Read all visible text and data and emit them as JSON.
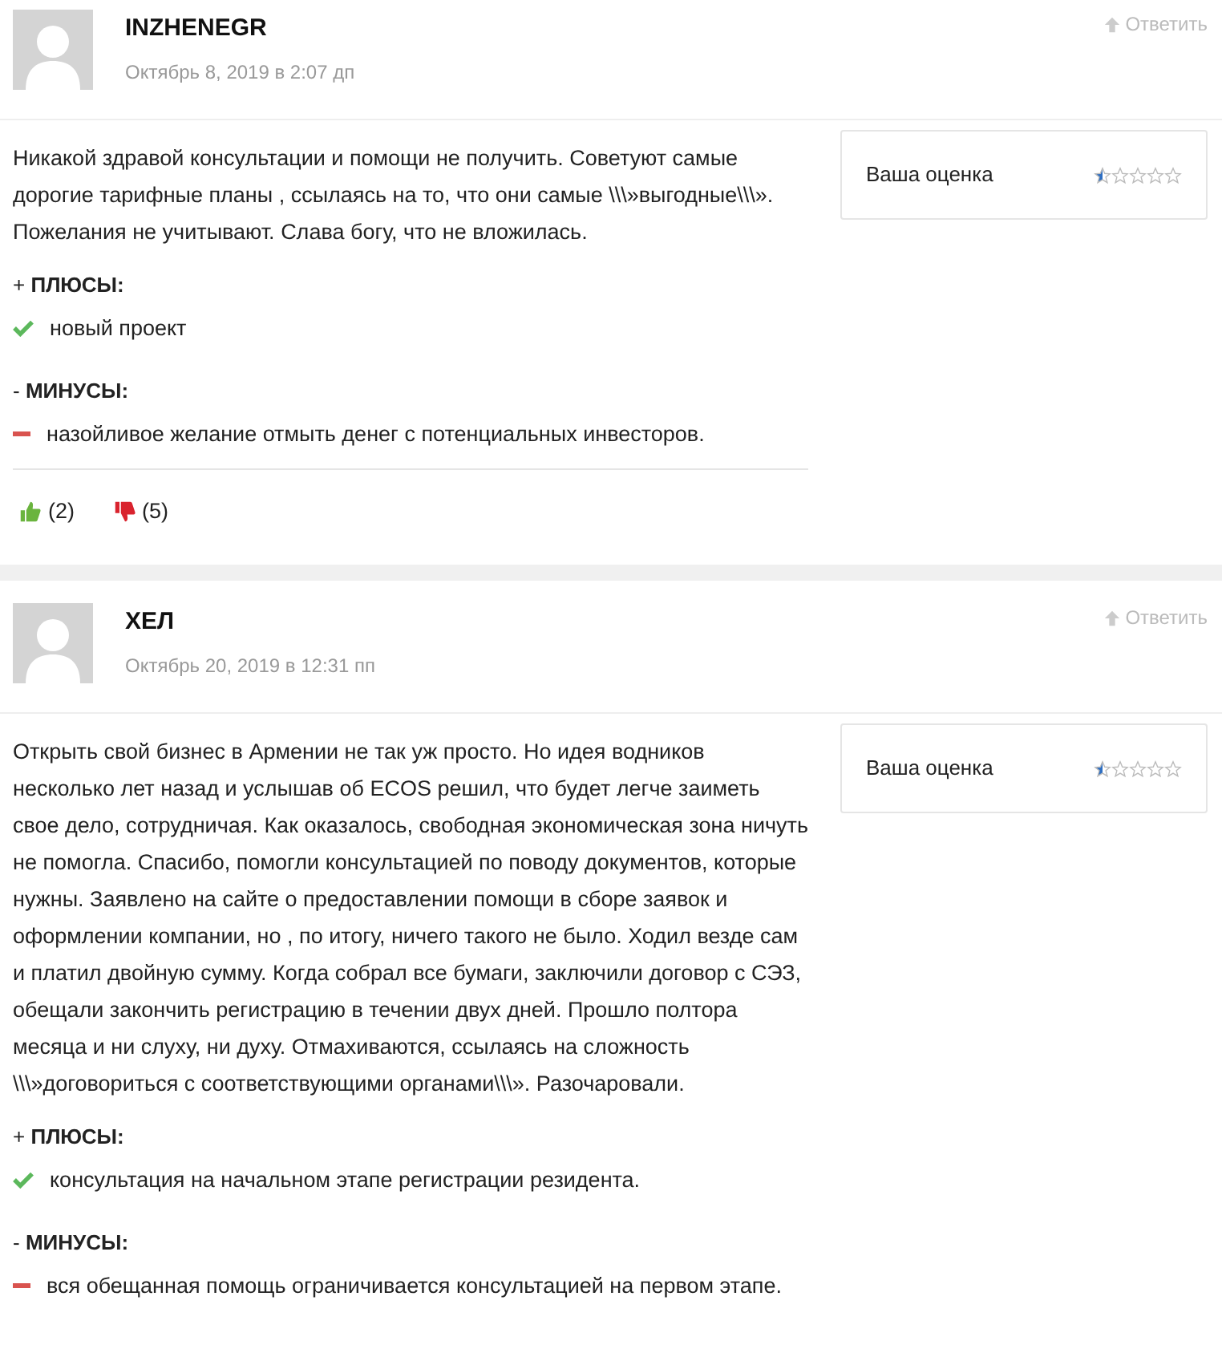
{
  "reviews": [
    {
      "author": "INZHENEGR",
      "date": "Октябрь 8, 2019 в 2:07 дп",
      "reply": "Ответить",
      "text": "Никакой здравой консультации и помощи не получить. Советуют самые дорогие тарифные планы , ссылаясь на то, что они самые \\\\\\»выгодные\\\\\\». Пожелания не учитывают. Слава богу, что не вложилась.",
      "rating_label": "Ваша оценка",
      "stars": 0.5,
      "pros_heading": "+ **ПЛЮСЫ:**",
      "pros": [
        "новый проект"
      ],
      "cons_heading": "- **МИНУСЫ:**",
      "cons": [
        "назойливое желание отмыть денег с потенциальных инвесторов."
      ],
      "likes": "(2)",
      "dislikes": "(5)"
    },
    {
      "author": "ХЕЛ",
      "date": "Октябрь 20, 2019 в 12:31 пп",
      "reply": "Ответить",
      "text": "Открыть свой бизнес в Армении не так уж просто. Но идея водников несколько лет назад и услышав об ECOS решил, что будет легче заиметь свое дело, сотрудничая. Как оказалось, свободная экономическая зона ничуть не помогла. Спасибо, помогли консультацией по поводу документов, которые нужны. Заявлено на сайте о предоставлении помощи в сборе заявок и оформлении компании, но , по итогу, ничего такого не было. Ходил везде сам и платил двойную сумму. Когда собрал все бумаги, заключили договор с СЭЗ, обещали закончить регистрацию в течении двух дней. Прошло полтора месяца и ни слуху, ни духу. Отмахиваются, ссылаясь на сложность \\\\\\»договориться с соответствующими органами\\\\\\». Разочаровали.",
      "rating_label": "Ваша оценка",
      "stars": 0.5,
      "pros_heading": "+ **ПЛЮСЫ:**",
      "pros": [
        "консультация на начальном этапе регистрации резидента."
      ],
      "cons_heading": "- **МИНУСЫ:**",
      "cons": [
        "вся обещанная помощь ограничивается консультацией на первом этапе."
      ]
    }
  ]
}
